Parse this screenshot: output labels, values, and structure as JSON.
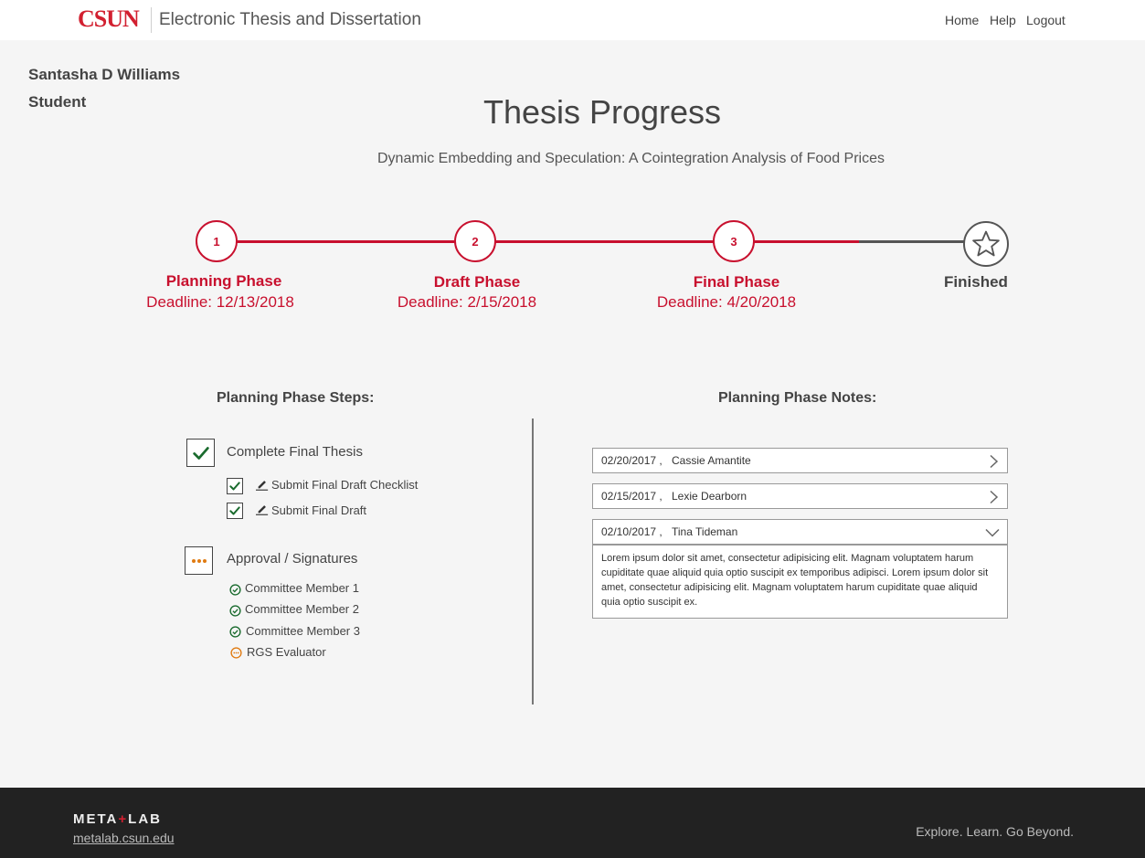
{
  "header": {
    "logo": "CSUN",
    "app_title": "Electronic Thesis and Dissertation",
    "nav": [
      "Home",
      "Help",
      "Logout"
    ]
  },
  "user": {
    "name": "Santasha D Williams",
    "role": "Student"
  },
  "page_title": "Thesis Progress",
  "thesis_title": "Dynamic Embedding and Speculation: A Cointegration Analysis of Food Prices",
  "progress": {
    "phases": [
      {
        "number": "1",
        "label": "Planning Phase",
        "deadline": "Deadline: 12/13/2018"
      },
      {
        "number": "2",
        "label": "Draft Phase",
        "deadline": "Deadline: 2/15/2018"
      },
      {
        "number": "3",
        "label": "Final Phase",
        "deadline": "Deadline: 4/20/2018"
      }
    ],
    "finished_label": "Finished",
    "accent_color": "#c8102e",
    "inactive_color": "#555555"
  },
  "steps": {
    "heading": "Planning Phase Steps:",
    "groups": [
      {
        "label": "Complete Final Thesis",
        "status": "complete",
        "items": [
          "Submit Final Draft Checklist",
          "Submit Final Draft"
        ]
      },
      {
        "label": "Approval / Signatures",
        "status": "in-progress",
        "items": [
          {
            "label": "Committee Member 1",
            "status": "approved"
          },
          {
            "label": "Committee Member 2",
            "status": "approved"
          },
          {
            "label": "Committee Member 3",
            "status": "approved"
          },
          {
            "label": "RGS Evaluator",
            "status": "pending"
          }
        ]
      }
    ]
  },
  "notes": {
    "heading": "Planning Phase Notes:",
    "items": [
      {
        "date": "02/20/2017 ,",
        "author": "Cassie Amantite",
        "expanded": false
      },
      {
        "date": "02/15/2017 ,",
        "author": "Lexie Dearborn",
        "expanded": false
      },
      {
        "date": "02/10/2017 ,",
        "author": "Tina Tideman",
        "expanded": true,
        "body": "Lorem ipsum dolor sit amet, consectetur adipisicing elit. Magnam voluptatem harum cupiditate quae aliquid quia optio suscipit ex temporibus adipisci. Lorem ipsum dolor sit amet, consectetur adipisicing elit. Magnam voluptatem harum cupiditate quae aliquid quia optio suscipit ex."
      }
    ]
  },
  "footer": {
    "logo_left": "META",
    "logo_plus": "+",
    "logo_right": "LAB",
    "link": "metalab.csun.edu",
    "tagline": "Explore. Learn. Go Beyond."
  }
}
